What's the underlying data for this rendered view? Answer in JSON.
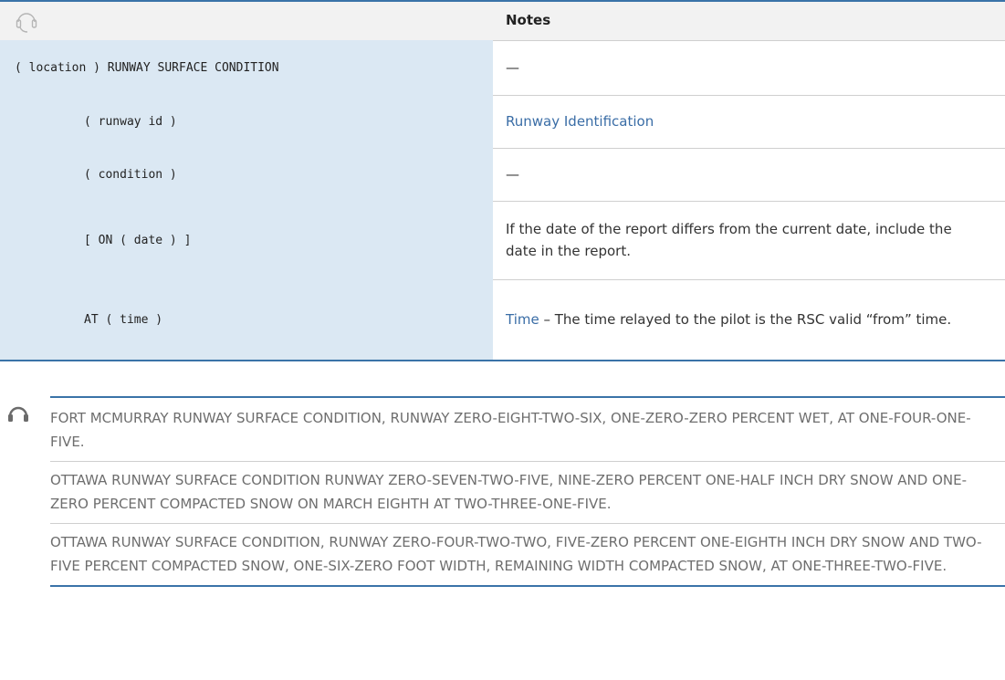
{
  "table": {
    "header": {
      "icon": "headset-icon",
      "notes_label": "Notes"
    },
    "rows": [
      {
        "phrase": "( location ) RUNWAY SURFACE CONDITION",
        "note": "—"
      },
      {
        "phrase": "( runway id )",
        "note_link": "Runway Identification"
      },
      {
        "phrase": "( condition )",
        "note": "—"
      },
      {
        "phrase": "[ ON ( date ) ]",
        "note": "If the date of the report differs from the current date, include the date in the report."
      },
      {
        "phrase": "AT ( time )",
        "note_link": "Time",
        "note": " – The time relayed to the pilot is the RSC valid “from” time."
      }
    ]
  },
  "examples": {
    "icon": "headset-icon",
    "items": [
      "FORT MCMURRAY RUNWAY SURFACE CONDITION, RUNWAY ZERO-EIGHT-TWO-SIX, ONE-ZERO-ZERO PERCENT WET, AT ONE-FOUR-ONE-FIVE.",
      "OTTAWA RUNWAY SURFACE CONDITION RUNWAY ZERO-SEVEN-TWO-FIVE, NINE-ZERO PERCENT ONE-HALF INCH DRY SNOW AND ONE-ZERO PERCENT COMPACTED SNOW ON MARCH EIGHTH AT TWO-THREE-ONE-FIVE.",
      "OTTAWA RUNWAY SURFACE CONDITION, RUNWAY ZERO-FOUR-TWO-TWO, FIVE-ZERO PERCENT ONE-EIGHTH INCH DRY SNOW AND TWO-FIVE PERCENT COMPACTED SNOW, ONE-SIX-ZERO FOOT WIDTH, REMAINING WIDTH COMPACTED SNOW, AT ONE-THREE-TWO-FIVE."
    ]
  },
  "colors": {
    "accent": "#3a73a8",
    "left_bg": "#dbe8f3",
    "link": "#3a6da6",
    "example_text": "#6e6e6e"
  }
}
